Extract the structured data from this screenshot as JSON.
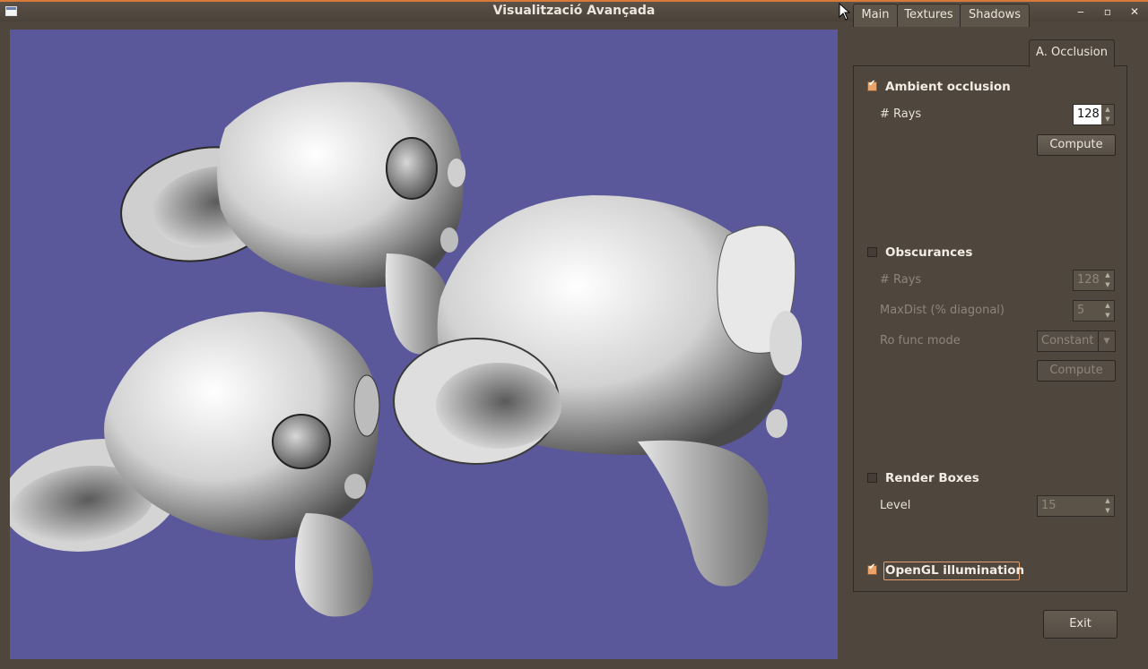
{
  "window": {
    "title": "Visualització Avançada"
  },
  "titlebar_buttons": {
    "minimize": "‒",
    "maximize": "▫",
    "close": "✕"
  },
  "tabs": [
    {
      "label": "Main"
    },
    {
      "label": "Textures"
    },
    {
      "label": "Shadows"
    },
    {
      "label": "A. Occlusion"
    }
  ],
  "ambient_occlusion": {
    "label": "Ambient occlusion",
    "checked": true,
    "rays_label": "# Rays",
    "rays_value": "128",
    "compute_label": "Compute"
  },
  "obscurances": {
    "label": "Obscurances",
    "checked": false,
    "rays_label": "# Rays",
    "rays_value": "128",
    "maxdist_label": "MaxDist (% diagonal)",
    "maxdist_value": "5",
    "ro_func_label": "Ro func mode",
    "ro_func_value": "Constant",
    "compute_label": "Compute"
  },
  "render_boxes": {
    "label": "Render Boxes",
    "checked": false,
    "level_label": "Level",
    "level_value": "15"
  },
  "opengl": {
    "label": "OpenGL illumination",
    "checked": true
  },
  "exit_label": "Exit",
  "colors": {
    "viewport_bg": "#5b579b",
    "window_bg": "#4f463d",
    "accent": "#d77a3a"
  }
}
